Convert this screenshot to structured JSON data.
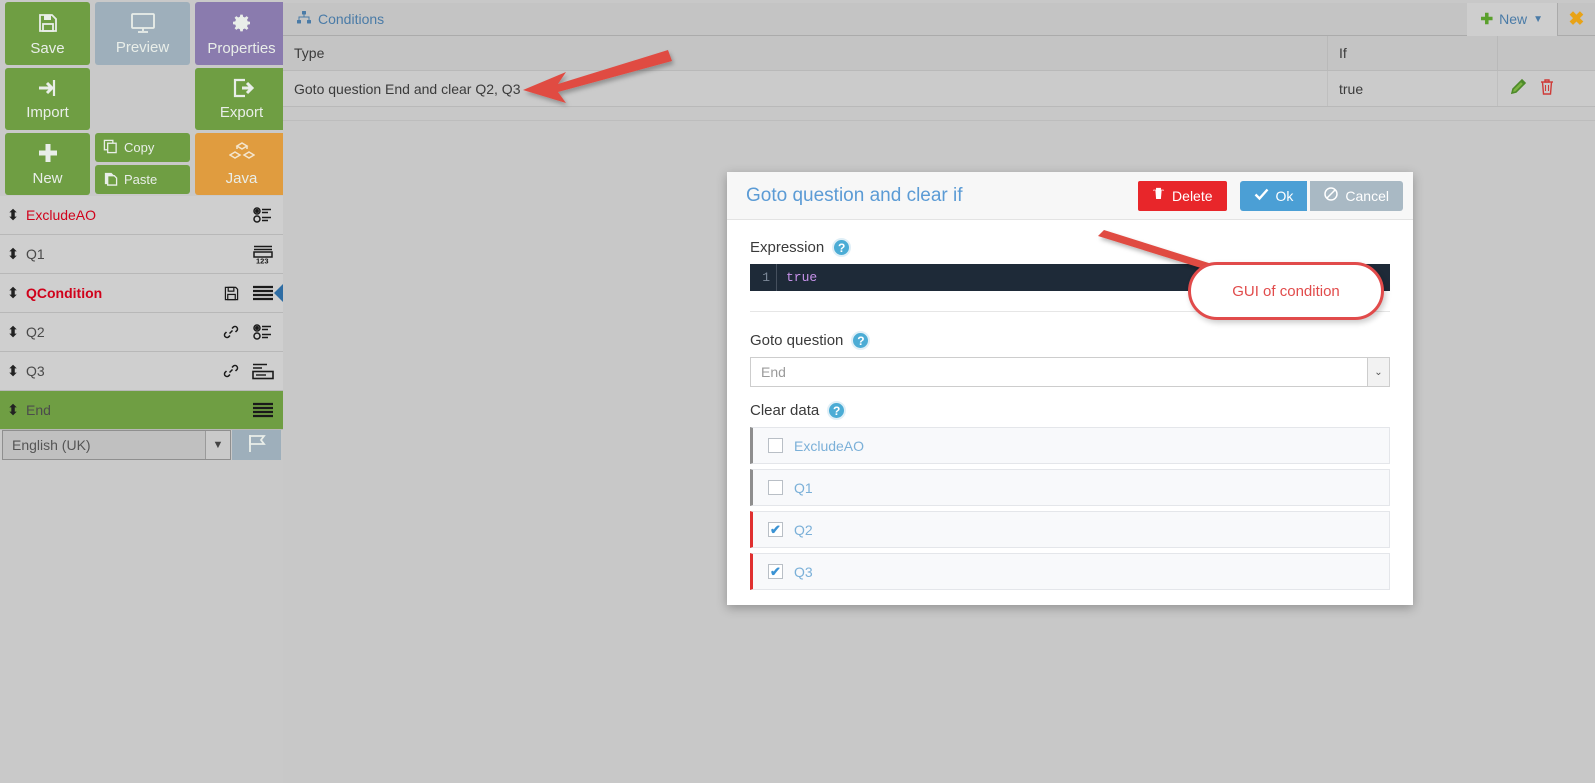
{
  "toolbar": {
    "save": "Save",
    "preview": "Preview",
    "properties": "Properties",
    "import": "Import",
    "export": "Export",
    "new": "New",
    "copy": "Copy",
    "paste": "Paste",
    "java": "Java"
  },
  "questions": [
    {
      "label": "ExcludeAO",
      "style": "red-thin",
      "icons": [
        "radio-list-icon"
      ]
    },
    {
      "label": "Q1",
      "style": "normal",
      "icons": [
        "number-input-icon"
      ]
    },
    {
      "label": "QCondition",
      "style": "red-bold",
      "icons": [
        "save-small-icon",
        "text-lines-icon"
      ],
      "selected": true
    },
    {
      "label": "Q2",
      "style": "normal",
      "icons": [
        "link-icon",
        "radio-list-icon"
      ]
    },
    {
      "label": "Q3",
      "style": "normal",
      "icons": [
        "link-icon",
        "text-field-icon"
      ]
    },
    {
      "label": "End",
      "style": "green",
      "icons": [
        "text-lines-icon"
      ]
    }
  ],
  "language": {
    "selected": "English (UK)",
    "flag_icon": "flag-icon"
  },
  "tabs": {
    "conditions_label": "Conditions",
    "conditions_icon": "sitemap-icon",
    "new_label": "New",
    "close_icon": "close-icon"
  },
  "conditions_table": {
    "columns": [
      "Type",
      "If",
      ""
    ],
    "rows": [
      {
        "type": "Goto question End and clear Q2, Q3",
        "if": "true",
        "actions": [
          "edit-pencil-icon",
          "delete-trash-icon"
        ]
      }
    ]
  },
  "dialog": {
    "title": "Goto question and clear if",
    "buttons": {
      "delete": "Delete",
      "ok": "Ok",
      "cancel": "Cancel"
    },
    "expression": {
      "label": "Expression",
      "line_number": "1",
      "code": "true",
      "help": "?"
    },
    "goto_question": {
      "label": "Goto question",
      "value": "End",
      "help": "?"
    },
    "clear_data": {
      "label": "Clear data",
      "help": "?",
      "items": [
        {
          "label": "ExcludeAO",
          "checked": false
        },
        {
          "label": "Q1",
          "checked": false
        },
        {
          "label": "Q2",
          "checked": true
        },
        {
          "label": "Q3",
          "checked": true
        }
      ]
    }
  },
  "annotations": {
    "callout_text": "GUI of condition",
    "arrow_color": "#e04b42",
    "callout_border_color": "#e14b4b"
  }
}
